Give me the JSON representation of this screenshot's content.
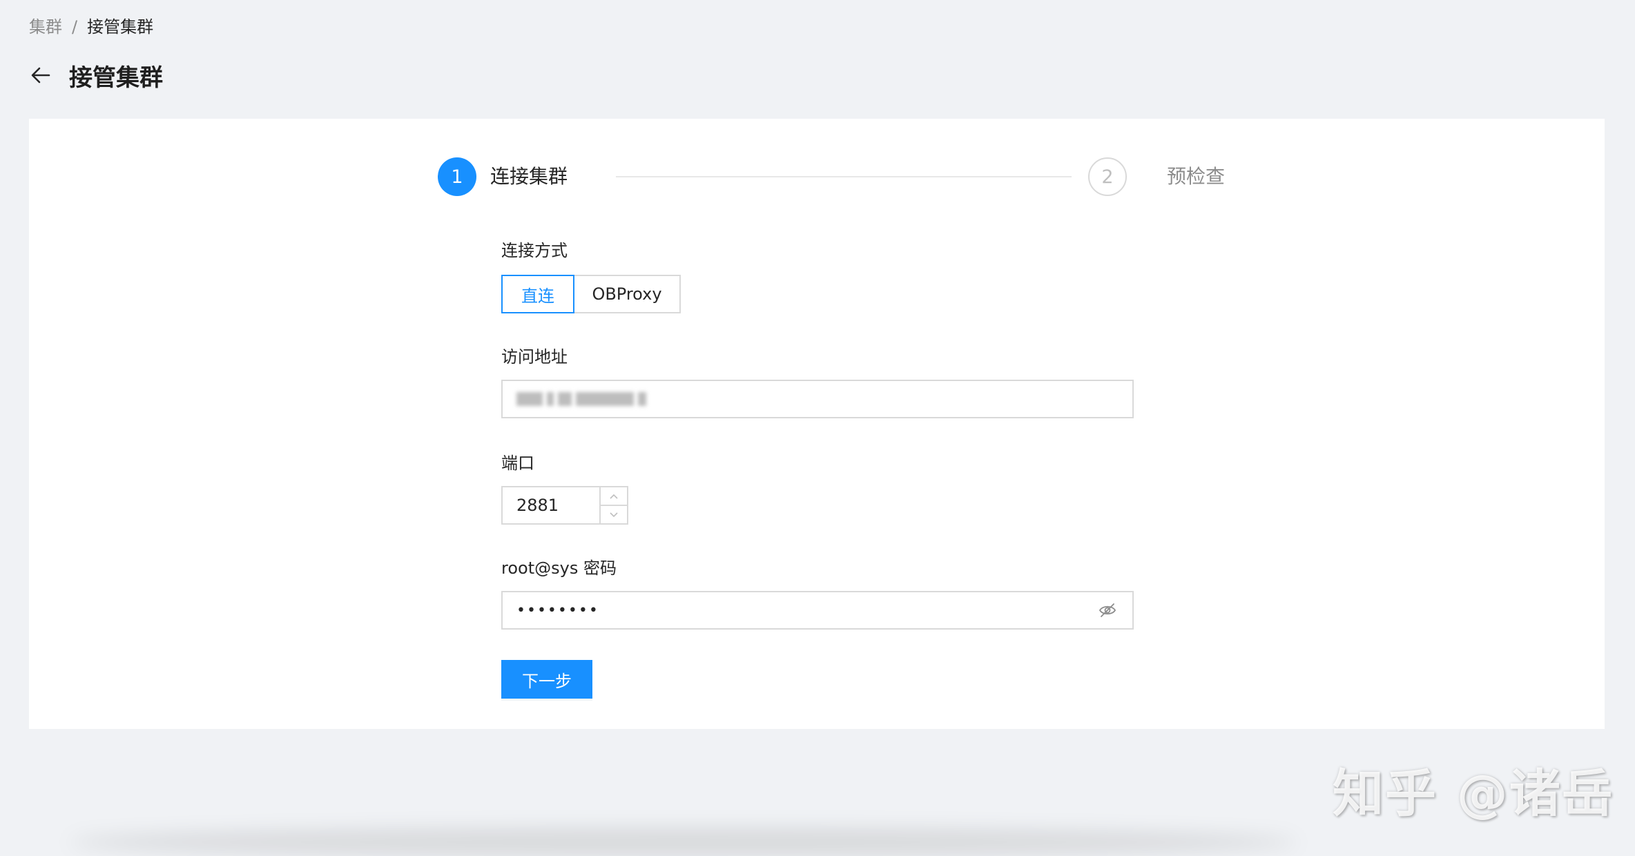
{
  "breadcrumb": {
    "items": [
      "集群",
      "接管集群"
    ],
    "separator": "/"
  },
  "header": {
    "title": "接管集群",
    "back_icon": "arrow-left-icon"
  },
  "steps": [
    {
      "number": "1",
      "title": "连接集群",
      "status": "active"
    },
    {
      "number": "2",
      "title": "预检查",
      "status": "wait"
    }
  ],
  "form": {
    "connection": {
      "label": "连接方式",
      "options": [
        {
          "label": "直连",
          "checked": true
        },
        {
          "label": "OBProxy",
          "checked": false
        }
      ]
    },
    "address": {
      "label": "访问地址"
    },
    "port": {
      "label": "端口",
      "value": "2881"
    },
    "password": {
      "label": "root@sys 密码",
      "masked_value": "••••••••",
      "toggle_icon": "eye-invisible-icon"
    },
    "next_button": "下一步"
  },
  "watermark": "知乎 @诸岳",
  "colors": {
    "primary": "#1890ff",
    "background": "#f0f2f5",
    "border": "#d9d9d9"
  }
}
